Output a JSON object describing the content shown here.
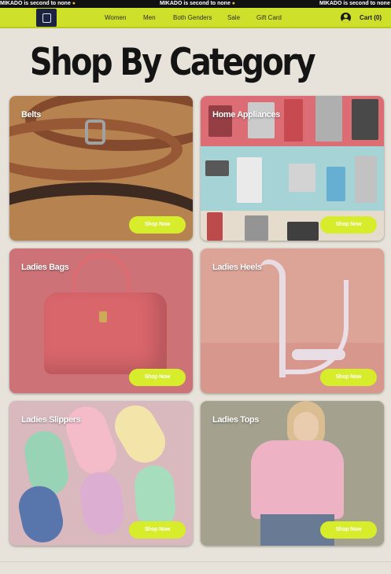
{
  "ticker": {
    "message": "MIKADO is second to none",
    "icon": "medal-icon"
  },
  "header": {
    "nav": [
      "Women",
      "Men",
      "Both Genders",
      "Sale",
      "Gift Card"
    ],
    "cart_label": "Cart (0)",
    "account_icon": "account-icon",
    "accent_color": "#cfe02a"
  },
  "main": {
    "title": "Shop By Category",
    "cta_label": "Shop Now",
    "categories": [
      {
        "label": "Belts"
      },
      {
        "label": "Home Appliances"
      },
      {
        "label": "Ladies Bags"
      },
      {
        "label": "Ladies Heels"
      },
      {
        "label": "Ladies Slippers"
      },
      {
        "label": "Ladies Tops"
      }
    ]
  }
}
